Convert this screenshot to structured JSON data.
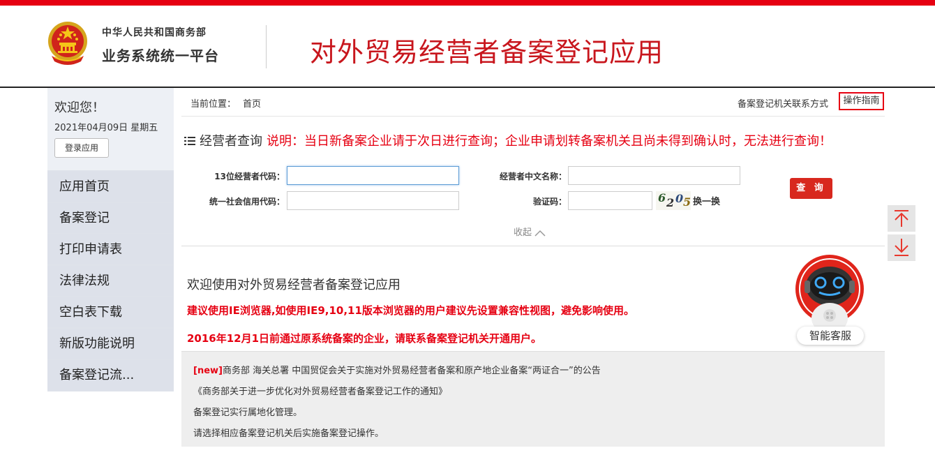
{
  "colors": {
    "brand_red": "#e60012",
    "title_red": "#c8161d",
    "button_red": "#d8281e",
    "sidebar_bg": "#dee2ea"
  },
  "header": {
    "ministry": "中华人民共和国商务部",
    "platform": "业务系统统一平台",
    "app_title": "对外贸易经营者备案登记应用",
    "emblem_icon": "national-emblem-icon"
  },
  "sidebar": {
    "welcome": "欢迎您！",
    "date": "2021年04月09日 星期五",
    "login_button": "登录应用",
    "items": [
      {
        "label": "应用首页"
      },
      {
        "label": "备案登记"
      },
      {
        "label": "打印申请表"
      },
      {
        "label": "法律法规"
      },
      {
        "label": "空白表下载"
      },
      {
        "label": "新版功能说明"
      },
      {
        "label": "备案登记流..."
      }
    ]
  },
  "breadcrumb": {
    "prefix": "当前位置：",
    "current": "首页"
  },
  "topright": {
    "contact": "备案登记机关联系方式",
    "guide": "操作指南"
  },
  "query": {
    "title": "经营者查询",
    "notice": "说明：当日新备案企业请于次日进行查询；企业申请划转备案机关且尚未得到确认时，无法进行查询！",
    "fields": {
      "code13_label": "13位经营者代码：",
      "code13_value": "",
      "name_label": "经营者中文名称：",
      "name_value": "",
      "credit_label": "统一社会信用代码：",
      "credit_value": "",
      "captcha_label": "验证码：",
      "captcha_value": ""
    },
    "captcha_chars": [
      "6",
      "2",
      "0",
      "5"
    ],
    "refresh": "换一换",
    "search_button": "查 询",
    "collapse": "收起"
  },
  "content": {
    "welcome_title": "欢迎使用对外贸易经营者备案登记应用",
    "warn1": "建议使用IE浏览器,如使用IE9,10,11版本浏览器的用户建议先设置兼容性视图，避免影响使用。",
    "warn2": "2016年12月1日前通过原系统备案的企业，请联系备案登记机关开通用户。"
  },
  "notices": {
    "new_tag": "[new]",
    "items": [
      "商务部 海关总署 中国贸促会关于实施对外贸易经营者备案和原产地企业备案“两证合一”的公告",
      "《商务部关于进一步优化对外贸易经营者备案登记工作的通知》",
      "备案登记实行属地化管理。",
      "请选择相应备案登记机关后实施备案登记操作。"
    ]
  },
  "assistant": {
    "label": "智能客服",
    "icon": "robot-icon"
  },
  "side_buttons": {
    "top_icon": "back-to-top-icon",
    "bottom_icon": "go-to-bottom-icon"
  }
}
